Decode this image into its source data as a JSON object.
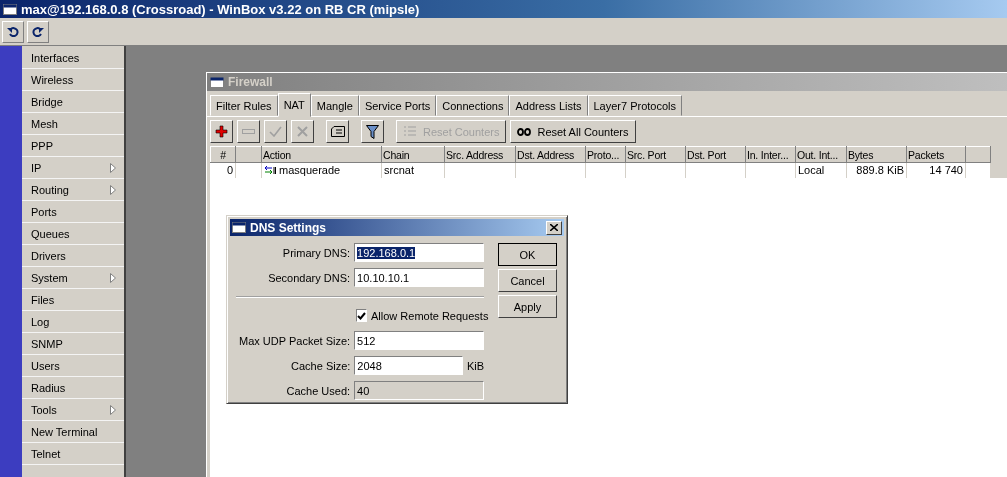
{
  "window": {
    "title": "max@192.168.0.8 (Crossroad) - WinBox v3.22 on RB CR (mipsle)"
  },
  "sidebar": {
    "items": [
      {
        "label": "Interfaces",
        "submenu": false
      },
      {
        "label": "Wireless",
        "submenu": false
      },
      {
        "label": "Bridge",
        "submenu": false
      },
      {
        "label": "Mesh",
        "submenu": false
      },
      {
        "label": "PPP",
        "submenu": false
      },
      {
        "label": "IP",
        "submenu": true
      },
      {
        "label": "Routing",
        "submenu": true
      },
      {
        "label": "Ports",
        "submenu": false
      },
      {
        "label": "Queues",
        "submenu": false
      },
      {
        "label": "Drivers",
        "submenu": false
      },
      {
        "label": "System",
        "submenu": true
      },
      {
        "label": "Files",
        "submenu": false
      },
      {
        "label": "Log",
        "submenu": false
      },
      {
        "label": "SNMP",
        "submenu": false
      },
      {
        "label": "Users",
        "submenu": false
      },
      {
        "label": "Radius",
        "submenu": false
      },
      {
        "label": "Tools",
        "submenu": true
      },
      {
        "label": "New Terminal",
        "submenu": false
      },
      {
        "label": "Telnet",
        "submenu": false
      }
    ]
  },
  "firewall": {
    "title": "Firewall",
    "tabs": [
      {
        "label": "Filter Rules",
        "selected": false
      },
      {
        "label": "NAT",
        "selected": true
      },
      {
        "label": "Mangle",
        "selected": false
      },
      {
        "label": "Service Ports",
        "selected": false
      },
      {
        "label": "Connections",
        "selected": false
      },
      {
        "label": "Address Lists",
        "selected": false
      },
      {
        "label": "Layer7 Protocols",
        "selected": false
      }
    ],
    "toolbar": [
      {
        "kind": "add",
        "disabled": false
      },
      {
        "kind": "remove",
        "disabled": true
      },
      {
        "kind": "enable",
        "disabled": true
      },
      {
        "kind": "disable",
        "disabled": true
      },
      {
        "kind": "comment",
        "disabled": false
      },
      {
        "kind": "filter",
        "disabled": false
      },
      {
        "kind": "reset",
        "label": "Reset Counters",
        "disabled": true
      },
      {
        "kind": "reset-all",
        "label": "Reset All Counters",
        "disabled": false
      }
    ],
    "table": {
      "columns": [
        "#",
        "",
        "Action",
        "Chain",
        "Src. Address",
        "Dst. Address",
        "Proto...",
        "Src. Port",
        "Dst. Port",
        "In. Inter...",
        "Out. Int...",
        "Bytes",
        "Packets"
      ],
      "rows": [
        {
          "cells": [
            "0",
            "",
            "masquerade",
            "srcnat",
            "",
            "",
            "",
            "",
            "",
            "",
            "Local",
            "889.8 KiB",
            "14 740"
          ]
        }
      ]
    }
  },
  "dns_dialog": {
    "title": "DNS Settings",
    "fields": [
      {
        "kind": "text",
        "label": "Primary DNS:",
        "value": "192.168.0.1",
        "selected": true
      },
      {
        "kind": "text",
        "label": "Secondary DNS:",
        "value": "10.10.10.1",
        "selected": false
      },
      {
        "kind": "separator"
      },
      {
        "kind": "checkbox",
        "label": "Allow Remote Requests",
        "checked": true
      },
      {
        "kind": "text",
        "label": "Max UDP Packet Size:",
        "value": "512",
        "selected": false
      },
      {
        "kind": "unit",
        "label": "Cache Size:",
        "value": "2048",
        "unit": "KiB"
      },
      {
        "kind": "readonly",
        "label": "Cache Used:",
        "value": "40"
      }
    ],
    "buttons": [
      "OK",
      "Cancel",
      "Apply"
    ]
  }
}
